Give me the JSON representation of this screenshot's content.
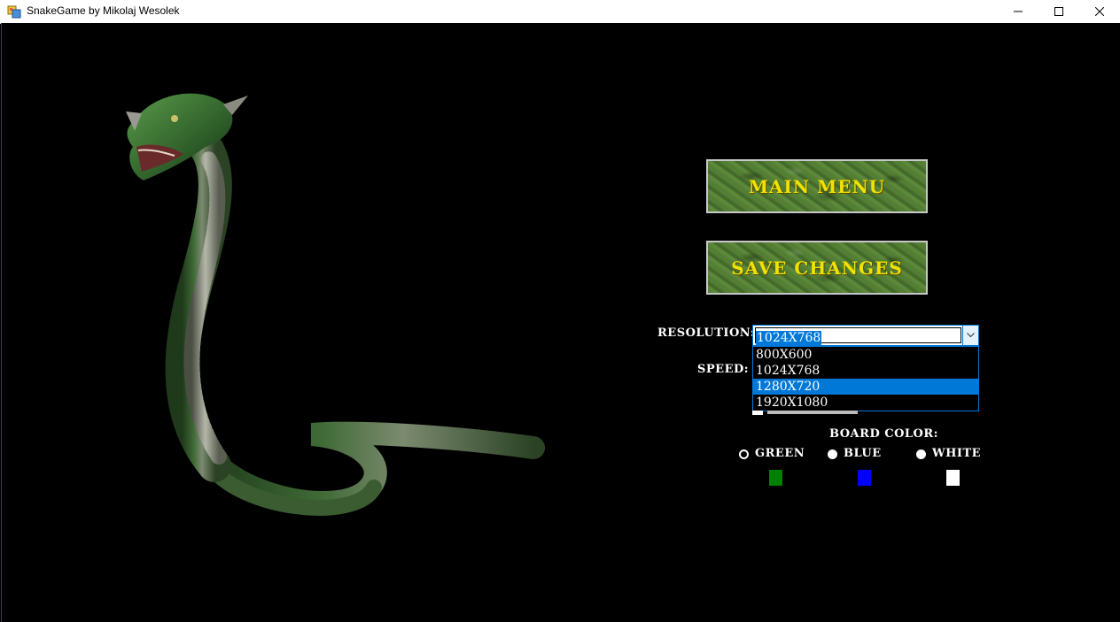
{
  "window": {
    "title": "SnakeGame by Mikolaj Wesolek",
    "controls": [
      "minimize",
      "maximize",
      "close"
    ]
  },
  "menu": {
    "main_menu_label": "MAIN MENU",
    "save_changes_label": "SAVE CHANGES"
  },
  "settings": {
    "resolution_label": "RESOLUTION:",
    "resolution_value": "1024X768",
    "resolution_options": [
      "800X600",
      "1024X768",
      "1280X720",
      "1920X1080"
    ],
    "resolution_highlighted": "1280X720",
    "speed_label": "SPEED:",
    "board_color_label": "BOARD COLOR:",
    "colors": [
      {
        "label": "GREEN",
        "swatch": "#008000",
        "selected": false
      },
      {
        "label": "BLUE",
        "swatch": "#0000ff",
        "selected": true
      },
      {
        "label": "WHITE",
        "swatch": "#ffffff",
        "selected": true
      }
    ]
  },
  "theme": {
    "button_text_color": "#f2e200",
    "accent": "#0078d7"
  }
}
